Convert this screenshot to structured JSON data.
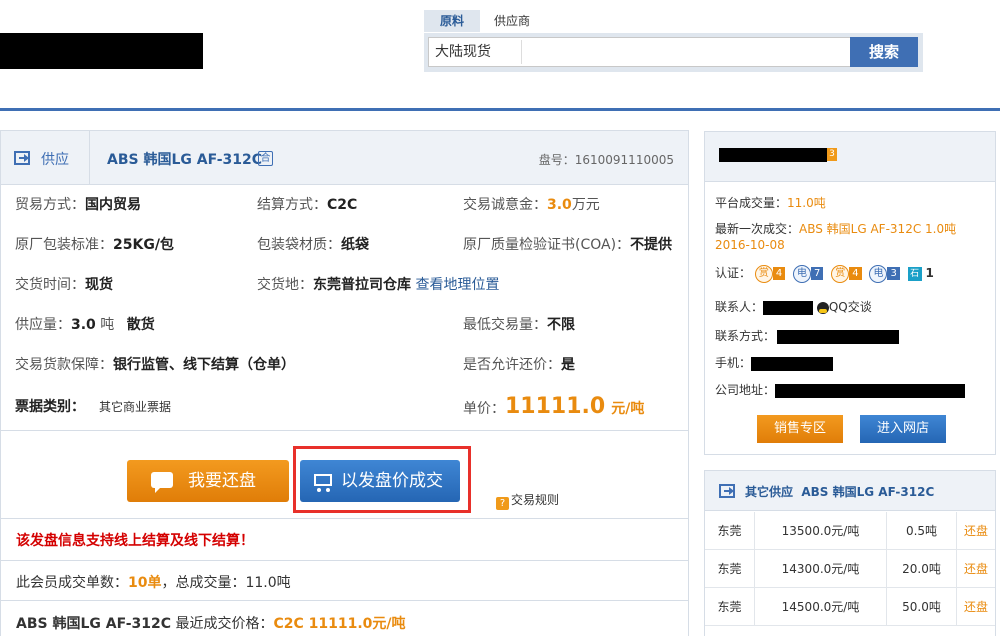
{
  "search": {
    "tabs": [
      {
        "label": "原料",
        "active": true
      },
      {
        "label": "供应商",
        "active": false
      }
    ],
    "value": "大陆现货",
    "button": "搜索"
  },
  "offer": {
    "type_label": "供应",
    "product": "ABS 韩国LG AF-312C",
    "lot_label": "盘号：",
    "lot_no": "1610091110005",
    "fields": {
      "trade_mode": {
        "label": "贸易方式：",
        "value": "国内贸易"
      },
      "settle_mode": {
        "label": "结算方式：",
        "value": "C2C"
      },
      "deposit": {
        "label": "交易诚意金：",
        "value": "3.0",
        "unit": "万元"
      },
      "pack_std": {
        "label": "原厂包装标准：",
        "value": "25KG/包"
      },
      "bag_material": {
        "label": "包装袋材质：",
        "value": "纸袋"
      },
      "coa": {
        "label": "原厂质量检验证书(COA)：",
        "value": "不提供"
      },
      "delivery_time": {
        "label": "交货时间：",
        "value": "现货"
      },
      "delivery_place": {
        "label": "交货地：",
        "value": "东莞普拉司仓库",
        "link": "查看地理位置"
      },
      "supply_qty": {
        "label": "供应量：",
        "value": "3.0",
        "unit": "吨",
        "extra": "散货"
      },
      "min_qty": {
        "label": "最低交易量：",
        "value": "不限"
      },
      "guarantee": {
        "label": "交易货款保障：",
        "value": "银行监管、线下结算（仓单）"
      },
      "bargain": {
        "label": "是否允许还价：",
        "value": "是"
      },
      "bill_type": {
        "label": "票据类别：",
        "value": "其它商业票据"
      },
      "price": {
        "label": "单价：",
        "value": "11111.0",
        "unit": "元/吨"
      }
    },
    "counter_button": "我要还盘",
    "deal_button": "以发盘价成交",
    "rules_link": "交易规则",
    "notice": "该发盘信息支持线上结算及线下结算！",
    "stat": {
      "prefix": "此会员成交单数：",
      "orders": "10单",
      "mid": "，总成交量：",
      "volume": "11.0吨"
    },
    "last_price": {
      "product": "ABS 韩国LG AF-312C",
      "label": "最近成交价格：",
      "value": "C2C 11111.0元/吨"
    }
  },
  "seller": {
    "badge": "3",
    "platform_volume": {
      "label": "平台成交量：",
      "value": "11.0吨"
    },
    "last_deal": {
      "label": "最新一次成交：",
      "value": "ABS 韩国LG AF-312C 1.0吨 2016-10-08"
    },
    "cert": {
      "label": "认证：",
      "items": [
        {
          "glyph": "赏",
          "n": "4"
        },
        {
          "glyph": "电",
          "n": "7"
        },
        {
          "glyph": "赏",
          "n": "4"
        },
        {
          "glyph": "电",
          "n": "3"
        }
      ],
      "stone": "石",
      "stone_n": "1"
    },
    "contact": {
      "label": "联系人：",
      "qq": "QQ交谈"
    },
    "contact_method": {
      "label": "联系方式："
    },
    "phone": {
      "label": "手机："
    },
    "address": {
      "label": "公司地址："
    },
    "sales_button": "销售专区",
    "shop_button": "进入网店"
  },
  "other": {
    "title_prefix": "其它供应",
    "product": "ABS 韩国LG AF-312C",
    "rows": [
      {
        "place": "东莞",
        "price": "13500.0元/吨",
        "qty": "0.5吨",
        "action": "还盘"
      },
      {
        "place": "东莞",
        "price": "14300.0元/吨",
        "qty": "20.0吨",
        "action": "还盘"
      },
      {
        "place": "东莞",
        "price": "14500.0元/吨",
        "qty": "50.0吨",
        "action": "还盘"
      }
    ]
  }
}
